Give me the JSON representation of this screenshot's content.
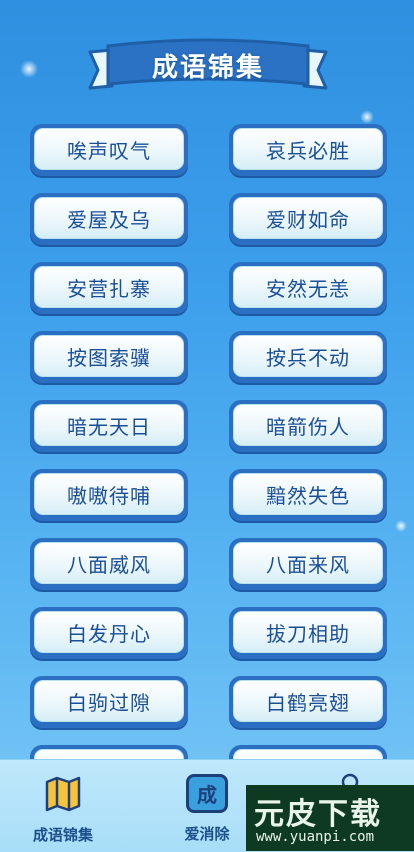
{
  "header": {
    "title": "成语锦集"
  },
  "idioms": [
    {
      "left": "唉声叹气",
      "right": "哀兵必胜"
    },
    {
      "left": "爱屋及乌",
      "right": "爱财如命"
    },
    {
      "left": "安营扎寨",
      "right": "安然无恙"
    },
    {
      "left": "按图索骥",
      "right": "按兵不动"
    },
    {
      "left": "暗无天日",
      "right": "暗箭伤人"
    },
    {
      "left": "嗷嗷待哺",
      "right": "黯然失色"
    },
    {
      "left": "八面威风",
      "right": "八面来风"
    },
    {
      "left": "白发丹心",
      "right": "拔刀相助"
    },
    {
      "left": "白驹过隙",
      "right": "白鹤亮翅"
    }
  ],
  "bottom_nav": {
    "items": [
      {
        "label": "成语锦集",
        "icon": "book-icon"
      },
      {
        "label": "爱消除",
        "icon": "cheng-tile-icon",
        "icon_char": "成"
      }
    ]
  },
  "watermark": {
    "title": "元皮下载",
    "url": "www.yuanpi.com"
  },
  "colors": {
    "accent": "#1a4f96",
    "card_border": "#2a6fc2",
    "background": "#3da0ec"
  }
}
